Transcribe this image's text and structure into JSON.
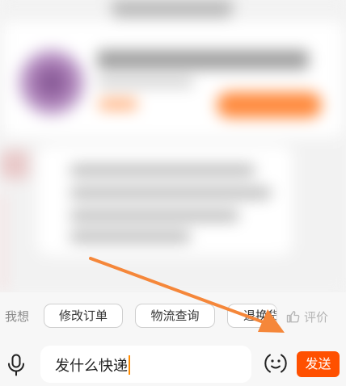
{
  "quick_replies": {
    "label": "我想",
    "chips": [
      {
        "label": "修改订单"
      },
      {
        "label": "物流查询"
      },
      {
        "label": "退换货"
      }
    ],
    "rate_label": "评价"
  },
  "composer": {
    "input_value": "发什么快递",
    "send_label": "发送"
  },
  "icons": {
    "mic": "microphone-icon",
    "emoji": "emoji-face-icon",
    "rate": "thumbs-up-icon"
  },
  "colors": {
    "accent": "#ff5000",
    "caret": "#ff8a00",
    "annotation_arrow": "#f5873a"
  }
}
